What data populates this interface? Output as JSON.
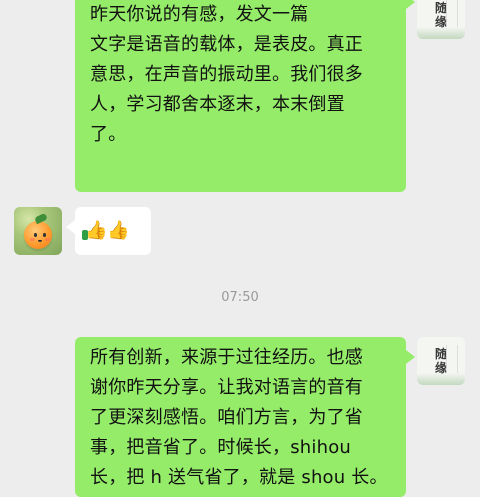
{
  "chat": {
    "timestamp": "07:50",
    "messages": [
      {
        "side": "right",
        "lines": [
          "昨天你说的有感，发文一篇",
          "",
          "文字是语音的载体，是表皮。真正",
          "意思，在声音的振动里。我们很多",
          "人，学习都舍本逐末，本末倒置",
          "了。"
        ],
        "avatar_text": [
          "随",
          "缘"
        ]
      },
      {
        "side": "left",
        "emojis": "👍👍"
      },
      {
        "side": "right",
        "lines": [
          "所有创新，来源于过往经历。也感",
          "谢你昨天分享。让我对语言的音有",
          "了更深刻感悟。咱们方言，为了省",
          "事，把音省了。时候长，shihou",
          "长，把 h 送气省了，就是 shou 长。"
        ],
        "avatar_text": [
          "随",
          "缘"
        ]
      }
    ]
  },
  "colors": {
    "background": "#ededed",
    "right_bubble": "#95ec69",
    "left_bubble": "#ffffff",
    "timestamp": "#9a9a9a"
  },
  "icons": {
    "thumbs_up": "thumbs-up-icon"
  }
}
